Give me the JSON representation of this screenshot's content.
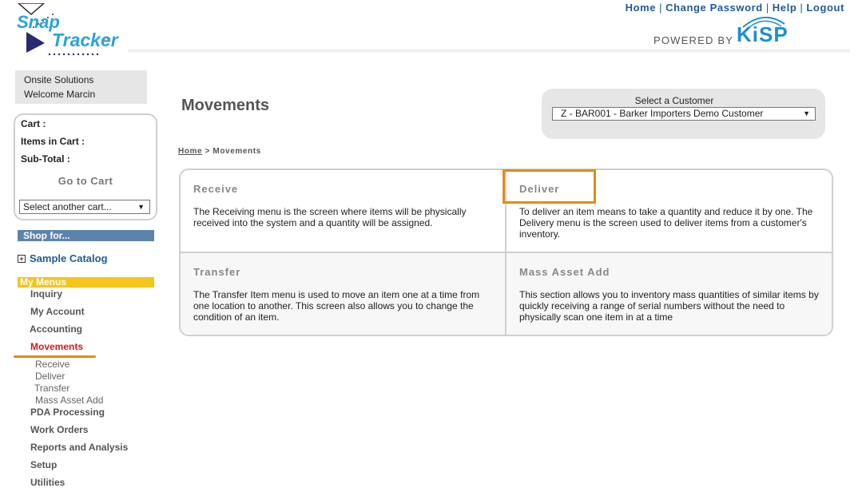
{
  "header": {
    "logo": {
      "line1": "Snap",
      "line2": "Tracker",
      "tm": "TM"
    },
    "links": [
      "Home",
      "Change Password",
      "Help",
      "Logout"
    ],
    "powered_by": "POWERED BY",
    "brand": "KiSP"
  },
  "sidebar": {
    "company": "Onsite Solutions",
    "welcome": "Welcome Marcin",
    "cart": {
      "cart_label": "Cart :",
      "items_label": "Items in Cart :",
      "subtotal_label": "Sub-Total :",
      "go_to_cart": "Go to Cart",
      "select_cart": "Select another cart..."
    },
    "shop_for": "Shop for...",
    "catalog": "Sample Catalog",
    "my_menus": "My Menus",
    "menus": [
      "Inquiry",
      "My Account",
      "Accounting",
      "Movements",
      "PDA Processing",
      "Work Orders",
      "Reports and Analysis",
      "Setup",
      "Utilities"
    ],
    "active_menu": "Movements",
    "submenus": [
      "Receive",
      "Deliver",
      "Transfer",
      "Mass Asset Add"
    ]
  },
  "main": {
    "title": "Movements",
    "customer": {
      "label": "Select a Customer",
      "value": "Z - BAR001 - Barker Importers Demo Customer"
    },
    "breadcrumb": {
      "home": "Home",
      "separator": ">",
      "current": "Movements"
    },
    "cards": [
      {
        "title": "Receive",
        "desc": "The Receiving menu is the screen where items will be physically received into the system and a quantity will be assigned."
      },
      {
        "title": "Deliver",
        "desc": "To deliver an item means to take a quantity and reduce it by one. The Delivery menu is the screen used to deliver items from a customer's inventory."
      },
      {
        "title": "Transfer",
        "desc": "The Transfer Item menu is used to move an item one at a time from one location to another. This screen also allows you to change the condition of an item."
      },
      {
        "title": "Mass Asset Add",
        "desc": "This section allows you to inventory mass quantities of similar items by quickly receiving a range of serial numbers without the need to physically scan one item in at a time"
      }
    ]
  },
  "colors": {
    "link": "#1d5c96",
    "accent": "#e08c1c",
    "active": "#d21b1b",
    "shop_bar": "#5b84ad",
    "menus_bar": "#f5c51b"
  }
}
